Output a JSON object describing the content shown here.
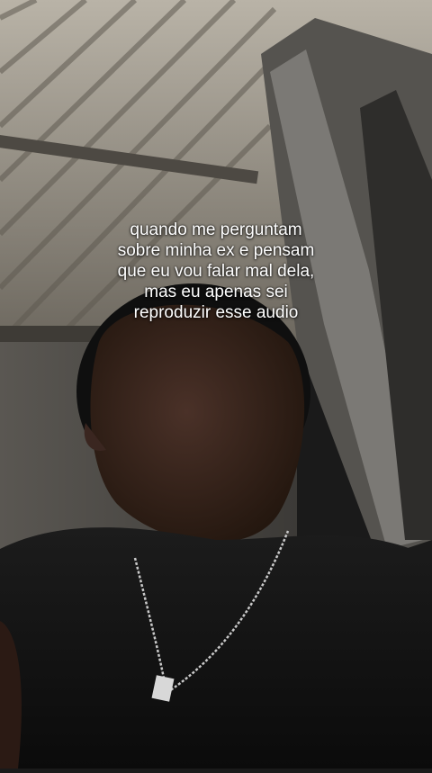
{
  "caption": {
    "lines": [
      "quando me perguntam",
      "sobre minha ex e pensam",
      "que eu vou falar mal dela,",
      "mas eu apenas sei",
      "reproduzir esse audio"
    ]
  },
  "colors": {
    "caption_text": "#ffffff",
    "ceiling": "#9a9488",
    "shadow": "#101010"
  }
}
